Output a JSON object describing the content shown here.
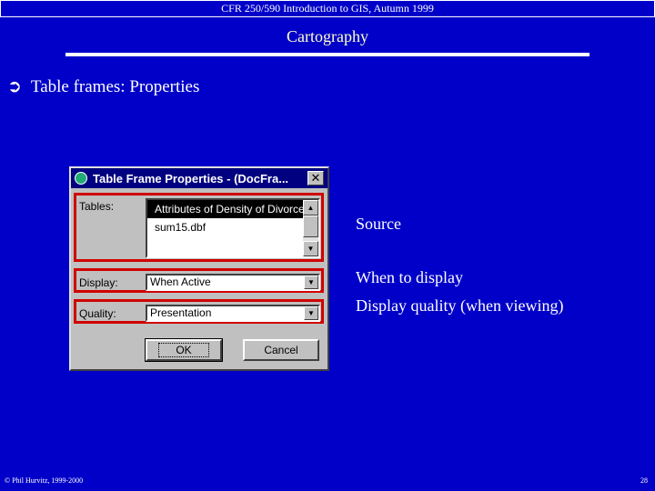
{
  "header": "CFR 250/590 Introduction to GIS, Autumn 1999",
  "title": "Cartography",
  "bullet": {
    "icon": "arrow-bullet-icon",
    "symbol": "➲",
    "text": "Table frames: Properties"
  },
  "dialog": {
    "title": "Table Frame Properties - (DocFra...",
    "close": "✕",
    "tables_label": "Tables:",
    "tables": [
      "Attributes of Density of Divorce",
      "sum15.dbf"
    ],
    "display_label": "Display:",
    "display_value": "When Active",
    "quality_label": "Quality:",
    "quality_value": "Presentation",
    "ok": "OK",
    "cancel": "Cancel"
  },
  "notes": {
    "source": "Source",
    "display": "When to display",
    "quality": "Display quality (when viewing)"
  },
  "footer": {
    "copyright": "© Phil Hurvitz, 1999-2000",
    "page": "28"
  },
  "colors": {
    "background": "#0000c8",
    "title": "#ffffc8",
    "highlight": "#d00000"
  }
}
